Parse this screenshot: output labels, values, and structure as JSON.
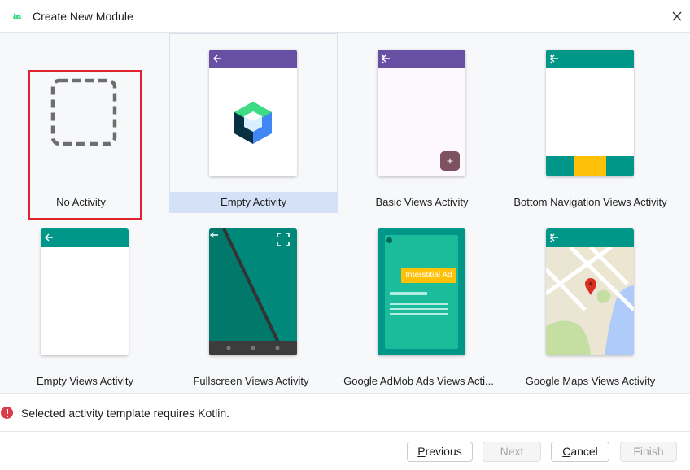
{
  "window": {
    "title": "Create New Module",
    "app_icon": "android-icon",
    "close_icon": "close-icon"
  },
  "templates": [
    {
      "label": "No Activity",
      "preview": "dashed-square"
    },
    {
      "label": "Empty Activity",
      "preview": "compose-logo",
      "selected": true
    },
    {
      "label": "Basic Views Activity",
      "preview": "fab-screen"
    },
    {
      "label": "Bottom Navigation Views Activity",
      "preview": "bottom-nav-screen"
    },
    {
      "label": "Empty Views Activity",
      "preview": "empty-screen"
    },
    {
      "label": "Fullscreen Views Activity",
      "preview": "fullscreen-screen"
    },
    {
      "label": "Google AdMob Ads Views Acti...",
      "preview": "admob-screen",
      "ad_label": "Interstitial Ad"
    },
    {
      "label": "Google Maps Views Activity",
      "preview": "maps-screen"
    }
  ],
  "status": {
    "message": "Selected activity template requires Kotlin.",
    "icon": "error-icon"
  },
  "buttons": {
    "previous": "Previous",
    "next": "Next",
    "cancel": "Cancel",
    "finish": "Finish"
  },
  "colors": {
    "purple": "#6750a4",
    "teal": "#009688",
    "teal_dark": "#00796b",
    "amber": "#ffc107",
    "error_red": "#e0232e",
    "selection": "#d5e1f7"
  }
}
